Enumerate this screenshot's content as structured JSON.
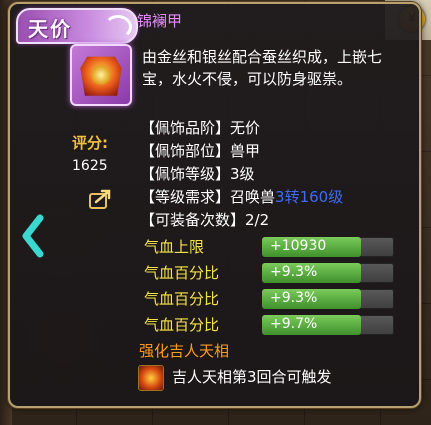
{
  "grade_banner": "天价",
  "item": {
    "name": "锦襕甲",
    "description": "由金丝和银丝配合蚕丝织成，上嵌七宝，水火不侵，可以防身驱祟。",
    "score_label": "评分:",
    "score_value": "1625"
  },
  "attributes": [
    {
      "label": "【佩饰品阶】",
      "value": "无价"
    },
    {
      "label": "【佩饰部位】",
      "value": "兽甲"
    },
    {
      "label": "【佩饰等级】",
      "value": "3级"
    },
    {
      "label": "【等级需求】",
      "value": "召唤兽",
      "highlight": "3转160级"
    },
    {
      "label": "【可装备次数】",
      "value": "2/2"
    }
  ],
  "stats": [
    {
      "label": "气血上限",
      "value": "+10930",
      "fill": 0.75
    },
    {
      "label": "气血百分比",
      "value": "+9.3%",
      "fill": 0.75
    },
    {
      "label": "气血百分比",
      "value": "+9.3%",
      "fill": 0.75
    },
    {
      "label": "气血百分比",
      "value": "+9.7%",
      "fill": 0.75
    }
  ],
  "skill": {
    "title": "强化吉人天相",
    "text": "吉人天相第3回合可触发",
    "icon": "fire-skill-icon"
  },
  "icons": {
    "share": "share-icon",
    "nav_left": "chevron-left-icon",
    "coin": "coin-bag-icon"
  },
  "colors": {
    "name": "#e58cff",
    "stat_label": "#f5e44a",
    "stat_bar_fill": "#5aaa3c",
    "highlight": "#3c6cf8",
    "skill_title": "#ff9c1e",
    "score_label": "#f0c040"
  }
}
